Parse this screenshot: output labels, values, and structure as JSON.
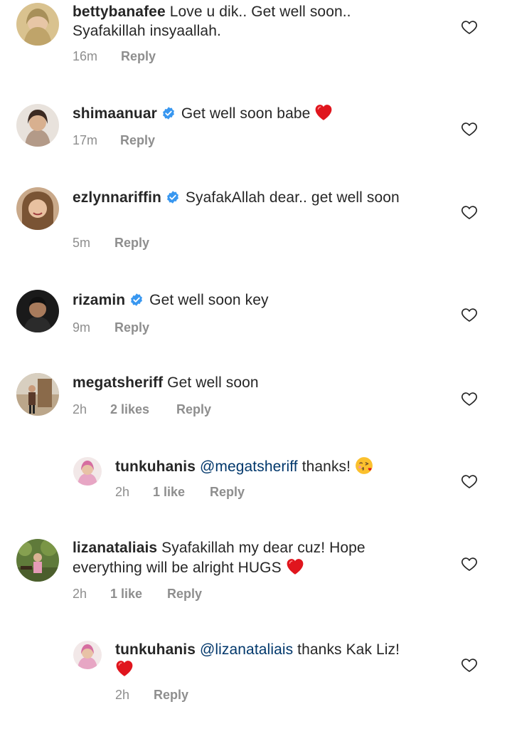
{
  "comments": [
    {
      "username": "bettybanafee",
      "verified": false,
      "text": "Love u dik.. Get well soon.. Syafakillah insyaallah.",
      "time": "16m",
      "likes": "",
      "reply": "Reply",
      "avatar": "avatar-woman-hijab"
    },
    {
      "username": "shimaanuar",
      "verified": true,
      "text": "Get well soon babe",
      "emoji": "red-heart",
      "time": "17m",
      "likes": "",
      "reply": "Reply",
      "avatar": "avatar-woman"
    },
    {
      "username": "ezlynnariffin",
      "verified": true,
      "text": "SyafakAllah dear.. get well soon",
      "time": "5m",
      "likes": "",
      "reply": "Reply",
      "avatar": "avatar-woman-smile"
    },
    {
      "username": "rizamin",
      "verified": true,
      "text": "Get well soon key",
      "time": "9m",
      "likes": "",
      "reply": "Reply",
      "avatar": "avatar-man"
    },
    {
      "username": "megatsheriff",
      "verified": false,
      "text": "Get well soon",
      "time": "2h",
      "likes": "2 likes",
      "reply": "Reply",
      "avatar": "avatar-outdoor"
    },
    {
      "username": "tunkuhanis",
      "verified": false,
      "mention": "@megatsheriff",
      "text": "thanks!",
      "emoji": "kiss-face",
      "time": "2h",
      "likes": "1 like",
      "reply": "Reply",
      "avatar": "avatar-pink"
    },
    {
      "username": "lizanataliais",
      "verified": false,
      "text": "Syafakillah my dear cuz! Hope everything will be alright HUGS",
      "emoji": "red-heart",
      "time": "2h",
      "likes": "1 like",
      "reply": "Reply",
      "avatar": "avatar-garden"
    },
    {
      "username": "tunkuhanis",
      "verified": false,
      "mention": "@lizanataliais",
      "text": "thanks Kak Liz!",
      "emoji": "red-heart",
      "time": "2h",
      "likes": "",
      "reply": "Reply",
      "avatar": "avatar-pink"
    }
  ],
  "icons": {
    "like": "heart-outline-icon",
    "verified": "verified-badge-icon"
  },
  "colors": {
    "text": "#262626",
    "meta": "#8e8e8e",
    "mention": "#00376b",
    "verified": "#3897f0",
    "heart": "#ed1c24"
  }
}
